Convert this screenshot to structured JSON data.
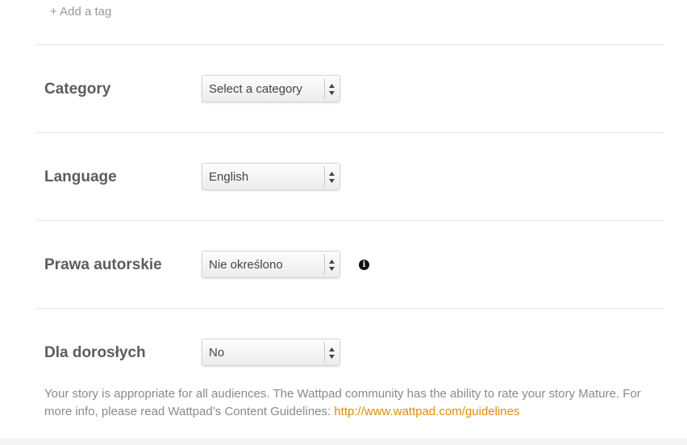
{
  "tags": {
    "add_label": "+ Add a tag"
  },
  "fields": {
    "category": {
      "label": "Category",
      "value": "Select a category"
    },
    "language": {
      "label": "Language",
      "value": "English"
    },
    "copyright": {
      "label": "Prawa autorskie",
      "value": "Nie określono",
      "info_icon": "info-icon"
    },
    "mature": {
      "label": "Dla dorosłych",
      "value": "No"
    }
  },
  "mature_help": {
    "text": "Your story is appropriate for all audiences. The Wattpad community has the ability to rate your story Mature. For more info, please read Wattpad’s Content Guidelines: ",
    "link": "http://www.wattpad.com/guidelines"
  },
  "colors": {
    "link": "#e38b06",
    "label": "#5c5c5c",
    "help_text": "#8a8a8a"
  }
}
